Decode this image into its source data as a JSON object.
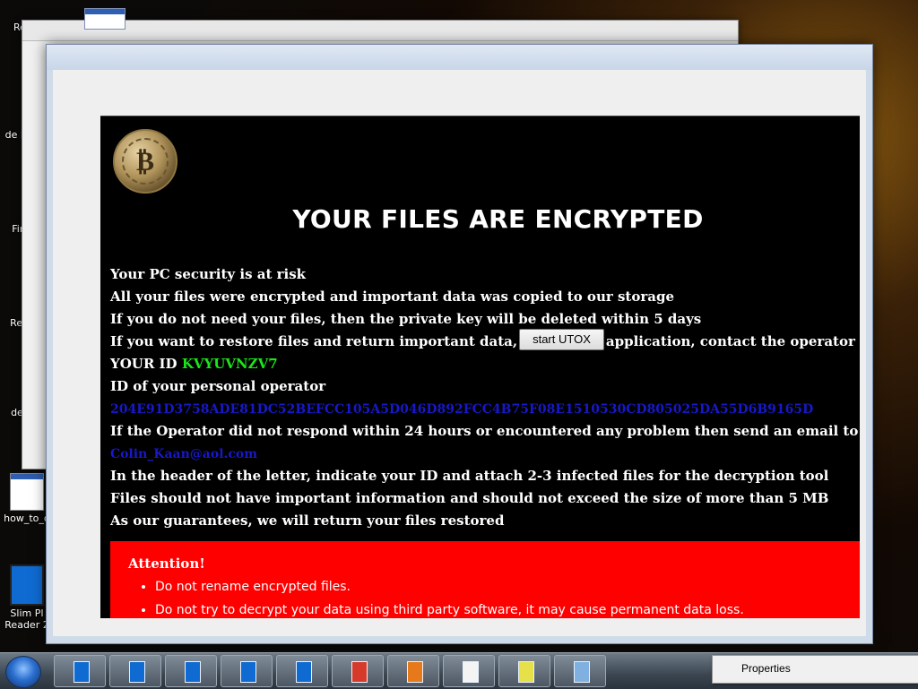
{
  "desktop": {
    "icons": [
      {
        "label": "Rec"
      },
      {
        "label": "de KVY"
      },
      {
        "label": "Firef"
      },
      {
        "label": "Read"
      },
      {
        "label": "desk"
      },
      {
        "label": "how_to_d"
      },
      {
        "label": "Slim PI Reader 2"
      }
    ]
  },
  "note": {
    "headline": "YOUR FILES ARE ENCRYPTED",
    "line1": "Your PC security is at risk",
    "line2": "All your files were encrypted and important data was copied to our storage",
    "line3": "If you do not need your files, then the private key will be deleted within 5 days",
    "line4_before": "If you want to restore files and return important data,",
    "start_utox_label": "start UTOX",
    "line4_after": "application, contact the operator and enter",
    "your_id_label": "YOUR ID",
    "your_id_value": "KVYUVNZV7",
    "operator_label": "ID of your personal operator",
    "operator_id": "204E91D3758ADE81DC52BEFCC105A5D046D892FCC4B75F08E1510530CD805025DA55D6B9165D",
    "line_support": "If the Operator did not respond within 24 hours or encountered any problem then send an email to our support",
    "support_email": "Colin_Kaan@aol.com",
    "line_header": "In the header of the letter, indicate your ID and attach 2-3 infected files for the decryption tool",
    "line_size": "Files should not have important information and should not exceed the size of more than 5 MB",
    "line_guarantee": "As our guarantees, we will return your files restored",
    "attention": {
      "title": "Attention!",
      "items": [
        "Do not rename encrypted files.",
        "Do not try to decrypt your data using third party software, it may cause permanent data loss."
      ]
    }
  },
  "context_menu": {
    "item": "Properties"
  },
  "colors": {
    "id_green": "#19e619",
    "link_blue": "#1818c8",
    "attention_red": "#ff0000"
  }
}
